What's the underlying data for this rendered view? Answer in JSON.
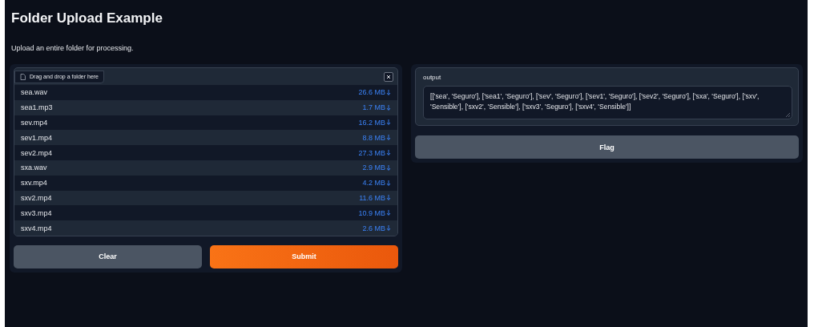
{
  "title": "Folder Upload Example",
  "description": "Upload an entire folder for processing.",
  "upload": {
    "label": "Drag and drop a folder here",
    "files": [
      {
        "name": "sea.wav",
        "size": "26.6 MB"
      },
      {
        "name": "sea1.mp3",
        "size": "1.7 MB"
      },
      {
        "name": "sev.mp4",
        "size": "16.2 MB"
      },
      {
        "name": "sev1.mp4",
        "size": "8.8 MB"
      },
      {
        "name": "sev2.mp4",
        "size": "27.3 MB"
      },
      {
        "name": "sxa.wav",
        "size": "2.9 MB"
      },
      {
        "name": "sxv.mp4",
        "size": "4.2 MB"
      },
      {
        "name": "sxv2.mp4",
        "size": "11.6 MB"
      },
      {
        "name": "sxv3.mp4",
        "size": "10.9 MB"
      },
      {
        "name": "sxv4.mp4",
        "size": "2.6 MB"
      }
    ]
  },
  "buttons": [
    {
      "label": "Clear",
      "kind": "secondary"
    },
    {
      "label": "Submit",
      "kind": "primary"
    }
  ],
  "output": {
    "label": "output",
    "value": "[['sea', 'Seguro'], ['sea1', 'Seguro'], ['sev', 'Seguro'], ['sev1', 'Seguro'], ['sev2', 'Seguro'], ['sxa', 'Seguro'], ['sxv', 'Sensible'], ['sxv2', 'Sensible'], ['sxv3', 'Seguro'], ['sxv4', 'Sensible']]"
  },
  "flag_button": {
    "label": "Flag"
  }
}
